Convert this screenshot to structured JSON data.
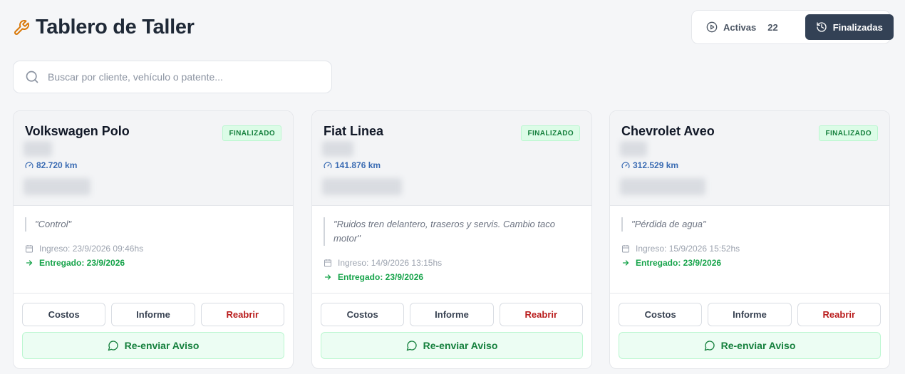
{
  "header": {
    "title": "Tablero de Taller",
    "tabs": {
      "active_label": "Activas",
      "active_count": "22",
      "finished_label": "Finalizadas"
    }
  },
  "search": {
    "placeholder": "Buscar por cliente, vehículo o patente..."
  },
  "colors": {
    "accent_icon": "#d97706",
    "finished_bg": "#334155",
    "status_green": "#15803d",
    "km_blue": "#3b6cb3",
    "reopen_red": "#b91c1c"
  },
  "cards": [
    {
      "vehicle": "Volkswagen Polo",
      "status": "FINALIZADO",
      "km": "82.720 km",
      "note": "\"Control\"",
      "ingreso": "Ingreso: 23/9/2026 09:46hs",
      "entregado": "Entregado: 23/9/2026"
    },
    {
      "vehicle": "Fiat Linea",
      "status": "FINALIZADO",
      "km": "141.876 km",
      "note": "\"Ruidos tren delantero, traseros y servis. Cambio taco motor\"",
      "ingreso": "Ingreso: 14/9/2026 13:15hs",
      "entregado": "Entregado: 23/9/2026"
    },
    {
      "vehicle": "Chevrolet Aveo",
      "status": "FINALIZADO",
      "km": "312.529 km",
      "note": "\"Pérdida de agua\"",
      "ingreso": "Ingreso: 15/9/2026 15:52hs",
      "entregado": "Entregado: 23/9/2026"
    }
  ],
  "card_actions": {
    "costs": "Costos",
    "report": "Informe",
    "reopen": "Reabrir",
    "resend": "Re-enviar Aviso"
  }
}
